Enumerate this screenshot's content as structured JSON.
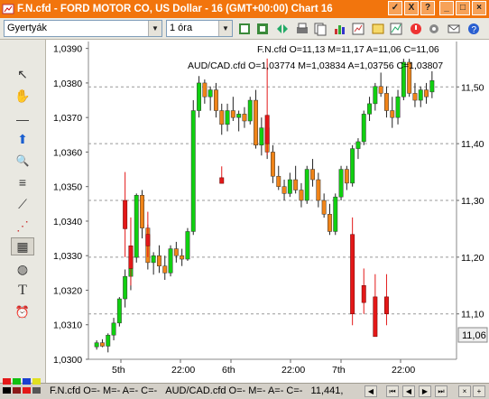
{
  "window": {
    "title": "F.N.cfd - FORD MOTOR CO, US Dollar - 16 (GMT+00:00)  Chart 16",
    "buttons": [
      "✓",
      "X",
      "?",
      "_",
      "□",
      "×"
    ]
  },
  "toolbar": {
    "chart_type": "Gyertyák",
    "timeframe": "1 óra"
  },
  "left_tools": [
    {
      "name": "cursor-icon",
      "glyph": "↖"
    },
    {
      "name": "hand-icon",
      "glyph": "✋"
    },
    {
      "name": "line-icon",
      "glyph": "—"
    },
    {
      "name": "arrow-up-icon",
      "glyph": "⬆"
    },
    {
      "name": "zoom-icon",
      "glyph": "🔍"
    },
    {
      "name": "fibonacci-icon",
      "glyph": "≡"
    },
    {
      "name": "fan-icon",
      "glyph": "⟋"
    },
    {
      "name": "indicator-icon",
      "glyph": "⋰"
    },
    {
      "name": "calculator-icon",
      "glyph": "▦"
    },
    {
      "name": "globe-icon",
      "glyph": "◍"
    },
    {
      "name": "text-icon",
      "glyph": "T"
    },
    {
      "name": "alarm-icon",
      "glyph": "⏰"
    }
  ],
  "chart": {
    "legend_fn": "F.N.cfd O=11,13 M=11,17 A=11,06 C=11,06",
    "legend_audcad": "AUD/CAD.cfd O=1,03774 M=1,03834 A=1,03756 C=1,03807",
    "left_ticks": [
      "1,0390",
      "1,0380",
      "1,0370",
      "1,0360",
      "1,0350",
      "1,0340",
      "1,0330",
      "1,0320",
      "1,0310",
      "1,0300"
    ],
    "right_ticks": [
      "11,50",
      "11,40",
      "11,30",
      "11,20",
      "11,10"
    ],
    "current_price": "11,06",
    "x_labels": [
      "5th",
      "22:00",
      "6th",
      "22:00",
      "7th",
      "22:00"
    ],
    "colors": {
      "up": "#10d010",
      "down": "#f08418",
      "red": "#e31818",
      "grid": "#999999"
    }
  },
  "chart_data": {
    "type": "candlestick",
    "series": [
      {
        "name": "F.N.cfd",
        "color_up": "#e31818",
        "color_down": "#e31818"
      },
      {
        "name": "AUD/CAD.cfd",
        "color_up": "#10d010",
        "color_down": "#f08418"
      }
    ],
    "left_axis": {
      "range": [
        1.03,
        1.0392
      ],
      "unit": "AUD/CAD"
    },
    "right_axis": {
      "range": [
        11.02,
        11.58
      ],
      "unit": "F.N"
    },
    "x": [
      "5th",
      "22:00",
      "6th",
      "22:00",
      "7th",
      "22:00"
    ],
    "audcad_ohlc": [
      [
        1.03036,
        1.03055,
        1.03028,
        1.03048
      ],
      [
        1.03048,
        1.03058,
        1.03035,
        1.03038
      ],
      [
        1.03038,
        1.03075,
        1.0302,
        1.0307
      ],
      [
        1.0307,
        1.0312,
        1.03055,
        1.03105
      ],
      [
        1.03105,
        1.0318,
        1.03095,
        1.03175
      ],
      [
        1.03175,
        1.0326,
        1.0315,
        1.0324
      ],
      [
        1.0324,
        1.033,
        1.032,
        1.03295
      ],
      [
        1.03295,
        1.0348,
        1.0328,
        1.03475
      ],
      [
        1.03475,
        1.0349,
        1.0335,
        1.0338
      ],
      [
        1.0338,
        1.0339,
        1.0326,
        1.0328
      ],
      [
        1.0328,
        1.0331,
        1.03245,
        1.033
      ],
      [
        1.033,
        1.0333,
        1.0325,
        1.0327
      ],
      [
        1.0327,
        1.033,
        1.0323,
        1.0325
      ],
      [
        1.0325,
        1.0333,
        1.0324,
        1.0332
      ],
      [
        1.0332,
        1.0334,
        1.0328,
        1.033
      ],
      [
        1.033,
        1.0332,
        1.0327,
        1.0329
      ],
      [
        1.0329,
        1.0338,
        1.03285,
        1.0337
      ],
      [
        1.0337,
        1.0375,
        1.0336,
        1.0372
      ],
      [
        1.0372,
        1.0382,
        1.037,
        1.038
      ],
      [
        1.038,
        1.0381,
        1.0374,
        1.0376
      ],
      [
        1.0376,
        1.0379,
        1.0372,
        1.0378
      ],
      [
        1.0378,
        1.038,
        1.037,
        1.0372
      ],
      [
        1.0372,
        1.0374,
        1.0365,
        1.0368
      ],
      [
        1.0368,
        1.0374,
        1.0366,
        1.0372
      ],
      [
        1.0372,
        1.0376,
        1.0369,
        1.037
      ],
      [
        1.037,
        1.0372,
        1.0366,
        1.0371
      ],
      [
        1.0371,
        1.0373,
        1.0367,
        1.0369
      ],
      [
        1.0369,
        1.0376,
        1.0368,
        1.0375
      ],
      [
        1.0375,
        1.0378,
        1.0361,
        1.0362
      ],
      [
        1.0362,
        1.037,
        1.0359,
        1.0367
      ],
      [
        1.0367,
        1.037,
        1.0358,
        1.036
      ],
      [
        1.036,
        1.0362,
        1.0351,
        1.0353
      ],
      [
        1.0353,
        1.0356,
        1.0349,
        1.035
      ],
      [
        1.035,
        1.0352,
        1.0346,
        1.0348
      ],
      [
        1.0348,
        1.0354,
        1.0347,
        1.0352
      ],
      [
        1.0352,
        1.0356,
        1.0348,
        1.0349
      ],
      [
        1.0349,
        1.0351,
        1.0344,
        1.0346
      ],
      [
        1.0346,
        1.0356,
        1.0345,
        1.0355
      ],
      [
        1.0355,
        1.0358,
        1.035,
        1.0352
      ],
      [
        1.0352,
        1.0354,
        1.0344,
        1.0346
      ],
      [
        1.0346,
        1.0348,
        1.0341,
        1.0342
      ],
      [
        1.0342,
        1.0345,
        1.0336,
        1.0337
      ],
      [
        1.0337,
        1.0348,
        1.0336,
        1.0347
      ],
      [
        1.0347,
        1.0356,
        1.0346,
        1.0355
      ],
      [
        1.0355,
        1.0356,
        1.0349,
        1.0351
      ],
      [
        1.0351,
        1.0362,
        1.035,
        1.0361
      ],
      [
        1.0361,
        1.0364,
        1.0358,
        1.0363
      ],
      [
        1.0363,
        1.0372,
        1.0362,
        1.0371
      ],
      [
        1.0371,
        1.0376,
        1.0369,
        1.0374
      ],
      [
        1.0374,
        1.038,
        1.0372,
        1.0379
      ],
      [
        1.0379,
        1.0383,
        1.0376,
        1.0377
      ],
      [
        1.0377,
        1.0379,
        1.037,
        1.0372
      ],
      [
        1.0372,
        1.0376,
        1.0367,
        1.037
      ],
      [
        1.037,
        1.0378,
        1.0368,
        1.0376
      ],
      [
        1.0376,
        1.0387,
        1.0375,
        1.0386
      ],
      [
        1.0386,
        1.0387,
        1.0376,
        1.0377
      ],
      [
        1.0377,
        1.038,
        1.0373,
        1.0375
      ],
      [
        1.0375,
        1.0379,
        1.0373,
        1.0378
      ],
      [
        1.0378,
        1.038,
        1.0374,
        1.0376
      ],
      [
        1.03774,
        1.03834,
        1.03756,
        1.03807
      ]
    ],
    "fn_ohlc": [
      [
        11.13,
        11.17,
        11.06,
        11.06
      ]
    ],
    "grid": true,
    "legend_position": "top-right"
  }
}
